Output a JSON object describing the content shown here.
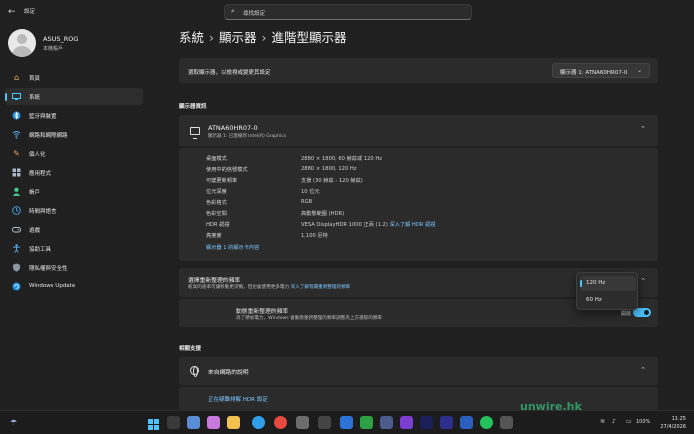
{
  "titlebar": {
    "app_title": "設定",
    "search_placeholder": "尋找設定"
  },
  "user": {
    "name": "ASUS_ROG",
    "account": "本機帳戶"
  },
  "sidebar": {
    "items": [
      {
        "label": "首頁",
        "icon": "home-icon"
      },
      {
        "label": "系統",
        "icon": "system-icon",
        "selected": true
      },
      {
        "label": "藍牙與裝置",
        "icon": "bluetooth-icon"
      },
      {
        "label": "網路和網際網路",
        "icon": "network-icon"
      },
      {
        "label": "個人化",
        "icon": "brush-icon"
      },
      {
        "label": "應用程式",
        "icon": "apps-icon"
      },
      {
        "label": "帳戶",
        "icon": "account-icon"
      },
      {
        "label": "時間與語言",
        "icon": "clock-globe-icon"
      },
      {
        "label": "遊戲",
        "icon": "gamepad-icon"
      },
      {
        "label": "協助工具",
        "icon": "accessibility-icon"
      },
      {
        "label": "隱私權與安全性",
        "icon": "shield-icon"
      },
      {
        "label": "Windows Update",
        "icon": "windows-update-icon"
      }
    ]
  },
  "breadcrumb": {
    "part1": "系統",
    "part2": "顯示器",
    "part3": "進階型顯示器",
    "separator": "›"
  },
  "select_display": {
    "label": "選取顯示器，以檢視或變更其設定",
    "value": "顯示器 1: ATNA60HR07-0"
  },
  "display_info": {
    "section_title": "顯示器資訊",
    "monitor_name": "ATNA60HR07-0",
    "monitor_sub": "顯示器 1: 已連線到 Intel(R) Graphics",
    "rows": [
      {
        "label": "桌面模式",
        "value": "2880 × 1800, 60 赫茲或 120 Hz"
      },
      {
        "label": "使用中的信號模式",
        "value": "2880 × 1800, 120 Hz"
      },
      {
        "label": "可變更新頻率",
        "value": "支援 (30 赫茲 - 120 赫茲)"
      },
      {
        "label": "位元深度",
        "value": "10 位元"
      },
      {
        "label": "色彩格式",
        "value": "RGB"
      },
      {
        "label": "色彩空間",
        "value": "高動態範圍 (HDR)"
      },
      {
        "label": "HDR 認證",
        "value": "VESA DisplayHDR 1000 正兩 (1.2)",
        "link": "深入了解 HDR 認證"
      },
      {
        "label": "亮度度",
        "value": "1,100 尼特"
      }
    ],
    "adapter_link": "顯示器 1 的顯示卡內容"
  },
  "refresh": {
    "title": "選擇重新整理的頻率",
    "desc": "較高的速率可讓移動更流暢，但也會使用更多電力",
    "desc_link": "深入了解有關重新整理的頻率",
    "options": [
      "120 Hz",
      "60 Hz"
    ],
    "selected": "120 Hz",
    "dynamic_title": "動態重新整理的頻率",
    "dynamic_desc": "為了節省電力，Windows 會動態重新整理的頻率調整為上方選取的頻率",
    "toggle_label": "開啟",
    "toggle_on": true
  },
  "related": {
    "section_title": "相關支援",
    "help_title": "來自網路的說明",
    "help_link": "正在疑難排解 HDR 設定"
  },
  "taskbar": {
    "battery": "100%",
    "time": "11:25",
    "date": "27/4/2026"
  },
  "watermark": "unwire.hk",
  "colors": {
    "accent": "#4cc2ff",
    "background": "#202020",
    "card": "#2b2b2b"
  }
}
